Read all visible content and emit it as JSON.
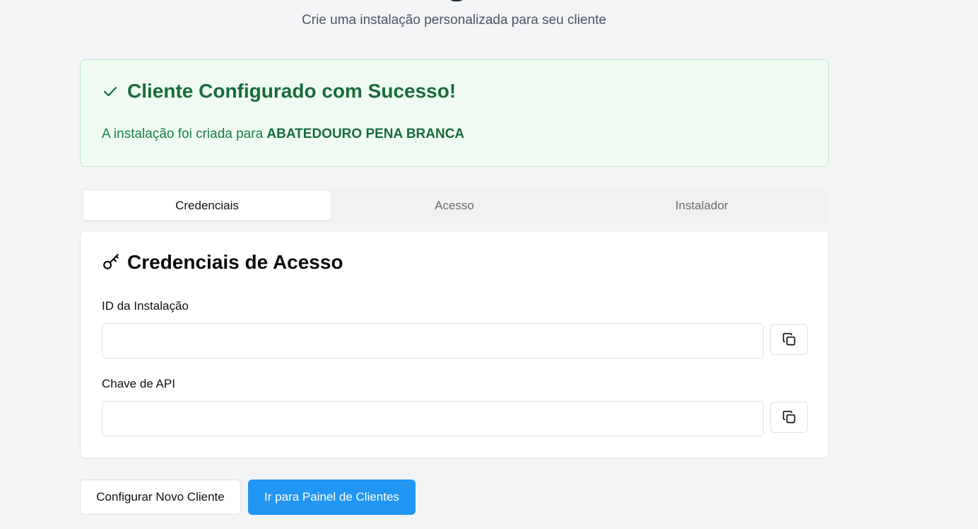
{
  "header": {
    "subtitle": "Crie uma instalação personalizada para seu cliente"
  },
  "success": {
    "icon": "check-icon",
    "title": "Cliente Configurado com Sucesso!",
    "message_prefix": "A instalação foi criada para ",
    "client_name": "ABATEDOURO PENA BRANCA",
    "colors": {
      "background": "#effbf2",
      "border": "#bbebc9",
      "text": "#176b3a"
    }
  },
  "tabs": [
    {
      "label": "Credenciais",
      "active": true
    },
    {
      "label": "Acesso",
      "active": false
    },
    {
      "label": "Instalador",
      "active": false
    }
  ],
  "credentials": {
    "icon": "key-icon",
    "title": "Credenciais de Acesso",
    "installation_id": {
      "label": "ID da Instalação",
      "value": "",
      "copy_icon": "copy-icon"
    },
    "api_key": {
      "label": "Chave de API",
      "value": "",
      "copy_icon": "copy-icon"
    }
  },
  "actions": {
    "new_client_label": "Configurar Novo Cliente",
    "dashboard_label": "Ir para Painel de Clientes",
    "primary_color": "#2196f3"
  }
}
